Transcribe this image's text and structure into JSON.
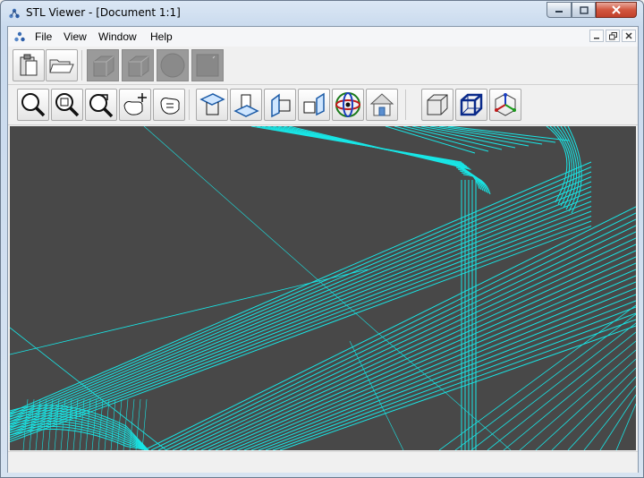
{
  "window": {
    "title": "STL Viewer - [Document 1:1]"
  },
  "menu": {
    "items": [
      "File",
      "View",
      "Window",
      "Help"
    ]
  },
  "toolbar1": {
    "buttons": [
      "new-document",
      "open-folder",
      "shaded-box-disabled",
      "wire-box-disabled",
      "sphere-disabled",
      "plane-disabled"
    ]
  },
  "toolbar2": {
    "buttons": [
      "zoom",
      "zoom-window",
      "zoom-previous",
      "pan-rotate",
      "pan",
      "view-top",
      "view-bottom",
      "view-left",
      "view-right",
      "view-iso-axis",
      "home",
      "shaded",
      "wireframe",
      "axes-triad"
    ]
  },
  "viewport": {
    "background": "#484848",
    "mesh_color": "#18e6e6"
  },
  "status": {
    "text": ""
  }
}
